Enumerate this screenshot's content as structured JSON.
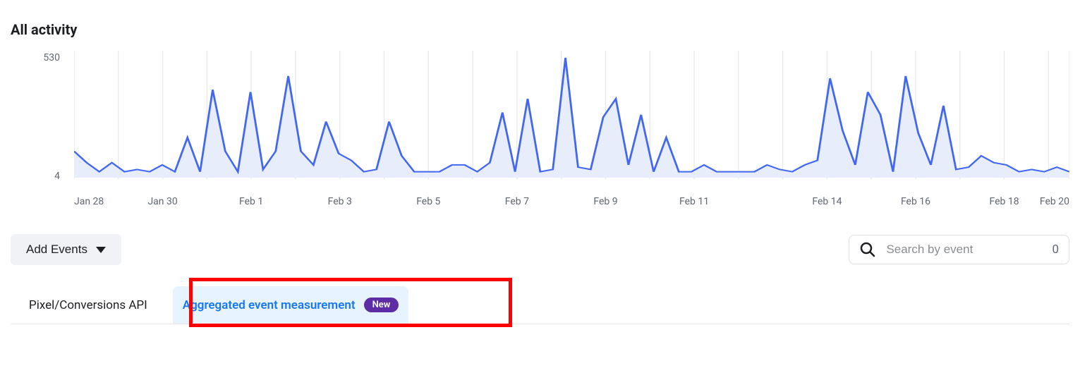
{
  "title": "All activity",
  "chart_data": {
    "type": "line",
    "ylabel_top": "530",
    "ylabel_bot": "4",
    "ylim": [
      4,
      530
    ],
    "x_ticks": [
      "Jan 28",
      "Jan 30",
      "Feb 1",
      "Feb 3",
      "Feb 5",
      "Feb 7",
      "Feb 9",
      "Feb 11",
      "Feb 14",
      "Feb 16",
      "Feb 18",
      "Feb 20"
    ],
    "x_tick_positions": [
      0,
      8.9,
      17.8,
      26.7,
      35.6,
      44.5,
      53.4,
      62.3,
      75.65,
      84.55,
      93.45,
      100
    ],
    "grid_positions": [
      0,
      4.45,
      8.9,
      13.35,
      17.8,
      22.25,
      26.7,
      31.15,
      35.6,
      40.05,
      44.5,
      48.95,
      53.4,
      57.85,
      62.3,
      66.75,
      71.2,
      75.65,
      80.1,
      84.55,
      89.0,
      93.45,
      97.9,
      100
    ],
    "values": [
      120,
      70,
      30,
      70,
      30,
      40,
      30,
      60,
      30,
      180,
      30,
      390,
      120,
      30,
      380,
      40,
      120,
      450,
      120,
      60,
      250,
      110,
      80,
      30,
      40,
      250,
      100,
      30,
      30,
      30,
      60,
      60,
      30,
      70,
      290,
      30,
      350,
      30,
      40,
      530,
      50,
      40,
      270,
      350,
      60,
      280,
      30,
      180,
      30,
      30,
      60,
      30,
      30,
      30,
      30,
      60,
      40,
      30,
      60,
      80,
      440,
      210,
      60,
      380,
      280,
      30,
      450,
      200,
      60,
      320,
      40,
      50,
      100,
      70,
      60,
      30,
      40,
      30,
      50,
      30
    ]
  },
  "controls": {
    "add_events_label": "Add Events",
    "search_placeholder": "Search by event",
    "search_count": "0"
  },
  "tabs": {
    "pixel_label": "Pixel/Conversions API",
    "aggregated_label": "Aggregated event measurement",
    "badge_label": "New"
  }
}
